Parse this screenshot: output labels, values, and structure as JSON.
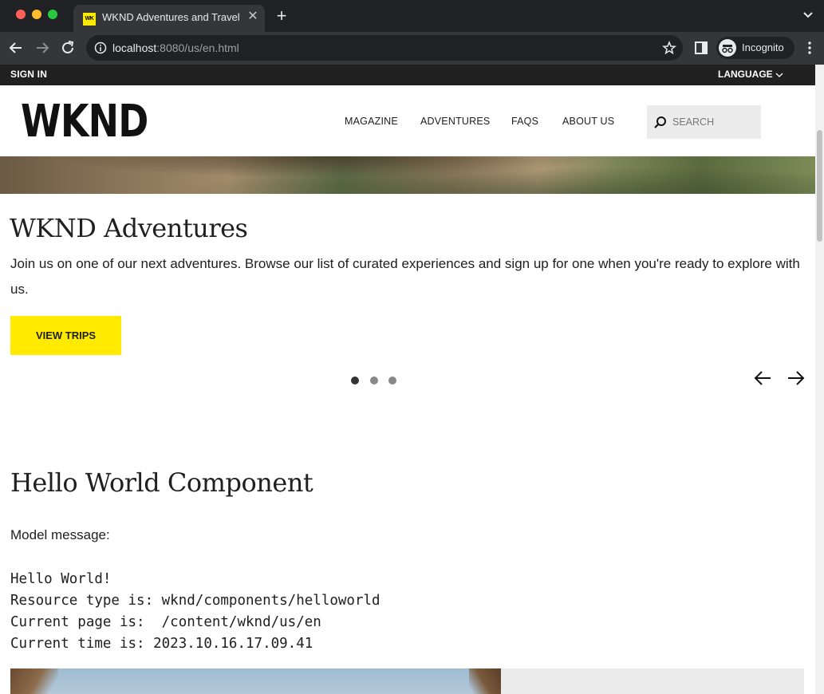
{
  "browser": {
    "tab_title": "WKND Adventures and Travel",
    "tab_favicon": "WK",
    "url_host": "localhost",
    "url_path": ":8080/us/en.html",
    "profile_label": "Incognito"
  },
  "utility": {
    "sign_in": "SIGN IN",
    "language": "LANGUAGE"
  },
  "header": {
    "logo": "WKND",
    "nav": [
      "MAGAZINE",
      "ADVENTURES",
      "FAQS",
      "ABOUT US"
    ],
    "search_placeholder": "SEARCH"
  },
  "hero": {
    "title": "WKND Adventures",
    "description": "Join us on one of our next adventures. Browse our list of curated experiences and sign up for one when you're ready to explore with us.",
    "button": "VIEW TRIPS",
    "slides_total": 3,
    "active_slide": 1
  },
  "hello_world": {
    "title": "Hello World Component",
    "label": "Model message:",
    "lines": [
      "Hello World!",
      "Resource type is: wknd/components/helloworld",
      "Current page is:  /content/wknd/us/en",
      "Current time is: 2023.10.16.17.09.41"
    ]
  },
  "colors": {
    "accent": "#ffea00",
    "utility_bar": "#202020",
    "chrome_dark": "#202124"
  }
}
